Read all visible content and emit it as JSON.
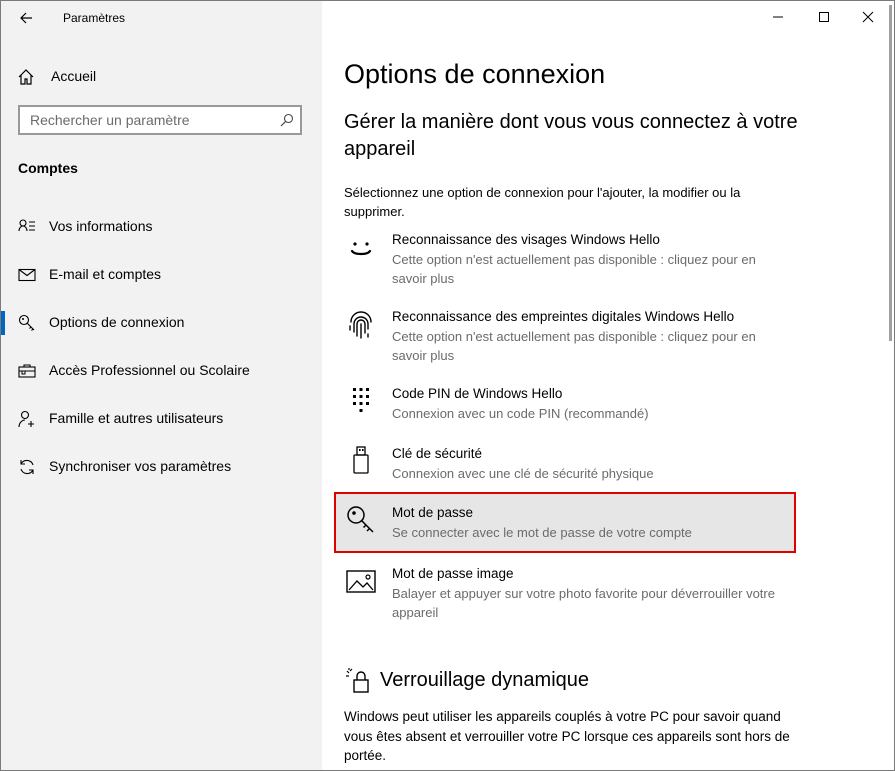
{
  "window": {
    "title": "Paramètres"
  },
  "sidebar": {
    "home_label": "Accueil",
    "search_placeholder": "Rechercher un paramètre",
    "section": "Comptes",
    "items": [
      {
        "label": "Vos informations",
        "icon": "person-info-icon"
      },
      {
        "label": "E-mail et comptes",
        "icon": "mail-icon"
      },
      {
        "label": "Options de connexion",
        "icon": "key-icon",
        "active": true
      },
      {
        "label": "Accès Professionnel ou Scolaire",
        "icon": "briefcase-icon"
      },
      {
        "label": "Famille et autres utilisateurs",
        "icon": "person-add-icon"
      },
      {
        "label": "Synchroniser vos paramètres",
        "icon": "sync-icon"
      }
    ]
  },
  "main": {
    "title": "Options de connexion",
    "subtitle": "Gérer la manière dont vous vous connectez à votre appareil",
    "intro": "Sélectionnez une option de connexion pour l'ajouter, la modifier ou la supprimer.",
    "options": [
      {
        "title": "Reconnaissance des visages Windows Hello",
        "desc": "Cette option n'est actuellement pas disponible : cliquez pour en savoir plus",
        "icon": "face-icon"
      },
      {
        "title": "Reconnaissance des empreintes digitales Windows Hello",
        "desc": "Cette option n'est actuellement pas disponible : cliquez pour en savoir plus",
        "icon": "fingerprint-icon"
      },
      {
        "title": "Code PIN de Windows Hello",
        "desc": "Connexion avec un code PIN (recommandé)",
        "icon": "pin-keypad-icon"
      },
      {
        "title": "Clé de sécurité",
        "desc": "Connexion avec une clé de sécurité physique",
        "icon": "usb-key-icon"
      },
      {
        "title": "Mot de passe",
        "desc": "Se connecter avec le mot de passe de votre compte",
        "icon": "key-icon",
        "highlighted": true
      },
      {
        "title": "Mot de passe image",
        "desc": "Balayer et appuyer sur votre photo favorite pour déverrouiller votre appareil",
        "icon": "picture-icon"
      }
    ],
    "dynamic_lock": {
      "title": "Verrouillage dynamique",
      "text": "Windows peut utiliser les appareils couplés à votre PC pour savoir quand vous êtes absent et verrouiller votre PC lorsque ces appareils sont hors de portée."
    }
  },
  "colors": {
    "accent": "#0067c0",
    "highlight_border": "#e00000",
    "sidebar_bg": "#f2f2f2"
  }
}
